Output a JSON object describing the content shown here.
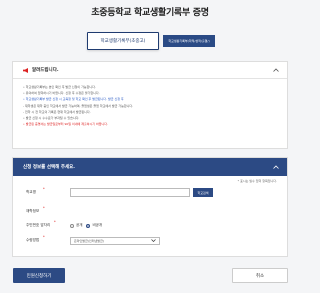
{
  "page": {
    "title": "초중등학교 학교생활기록부 증명"
  },
  "tabs": [
    {
      "label": "학교생활기록부(초중고)"
    },
    {
      "label": "학교생활기록부(학적/성적/출결/)"
    }
  ],
  "notice": {
    "title": "알려드립니다.",
    "items": [
      "• 학교생활기록부는 본인 확인 후 발급 신청이 가능합니다.",
      "• 유의하여 입력하시기 바랍니다. 신청 후 수정은 불가합니다.",
      "• 학교생활기록부 발급 신청 시 교육청 및 학교 확인 후 발급됩니다. 발급 신청 후",
      "  - 재학생은 재학 중인 학교에서 발급 가능하며, 졸업생은 졸업 학교에서 발급 가능합니다.",
      "  - 전학 시 전 학교의 기록은 현재 학교에서 발급됩니다.",
      "• 발급 신청 시 수수료가 부과될 수 있습니다.",
      "• 발급된 증명서는 발급일로부터 90일 이내에 제출하시기 바랍니다."
    ]
  },
  "form": {
    "title": "신청 정보를 선택해 주세요.",
    "required_note": "* 표시는 필수 입력 항목입니다.",
    "fields": [
      {
        "label": "학교명",
        "required": true,
        "button": "학교검색"
      },
      {
        "label": "재학정보",
        "required": true
      },
      {
        "label": "주민번호 앞자리",
        "required": true
      },
      {
        "label": "수령방법",
        "required": true
      }
    ],
    "radio_options": [
      {
        "label": "공개",
        "selected": false
      },
      {
        "label": "비공개",
        "selected": true
      }
    ],
    "receive_method": "온라인발급(인터넷발급)"
  },
  "actions": {
    "apply": "민원신청하기",
    "cancel": "취소"
  },
  "colors": {
    "primary": "#2c4a84",
    "required": "#dd2222"
  }
}
